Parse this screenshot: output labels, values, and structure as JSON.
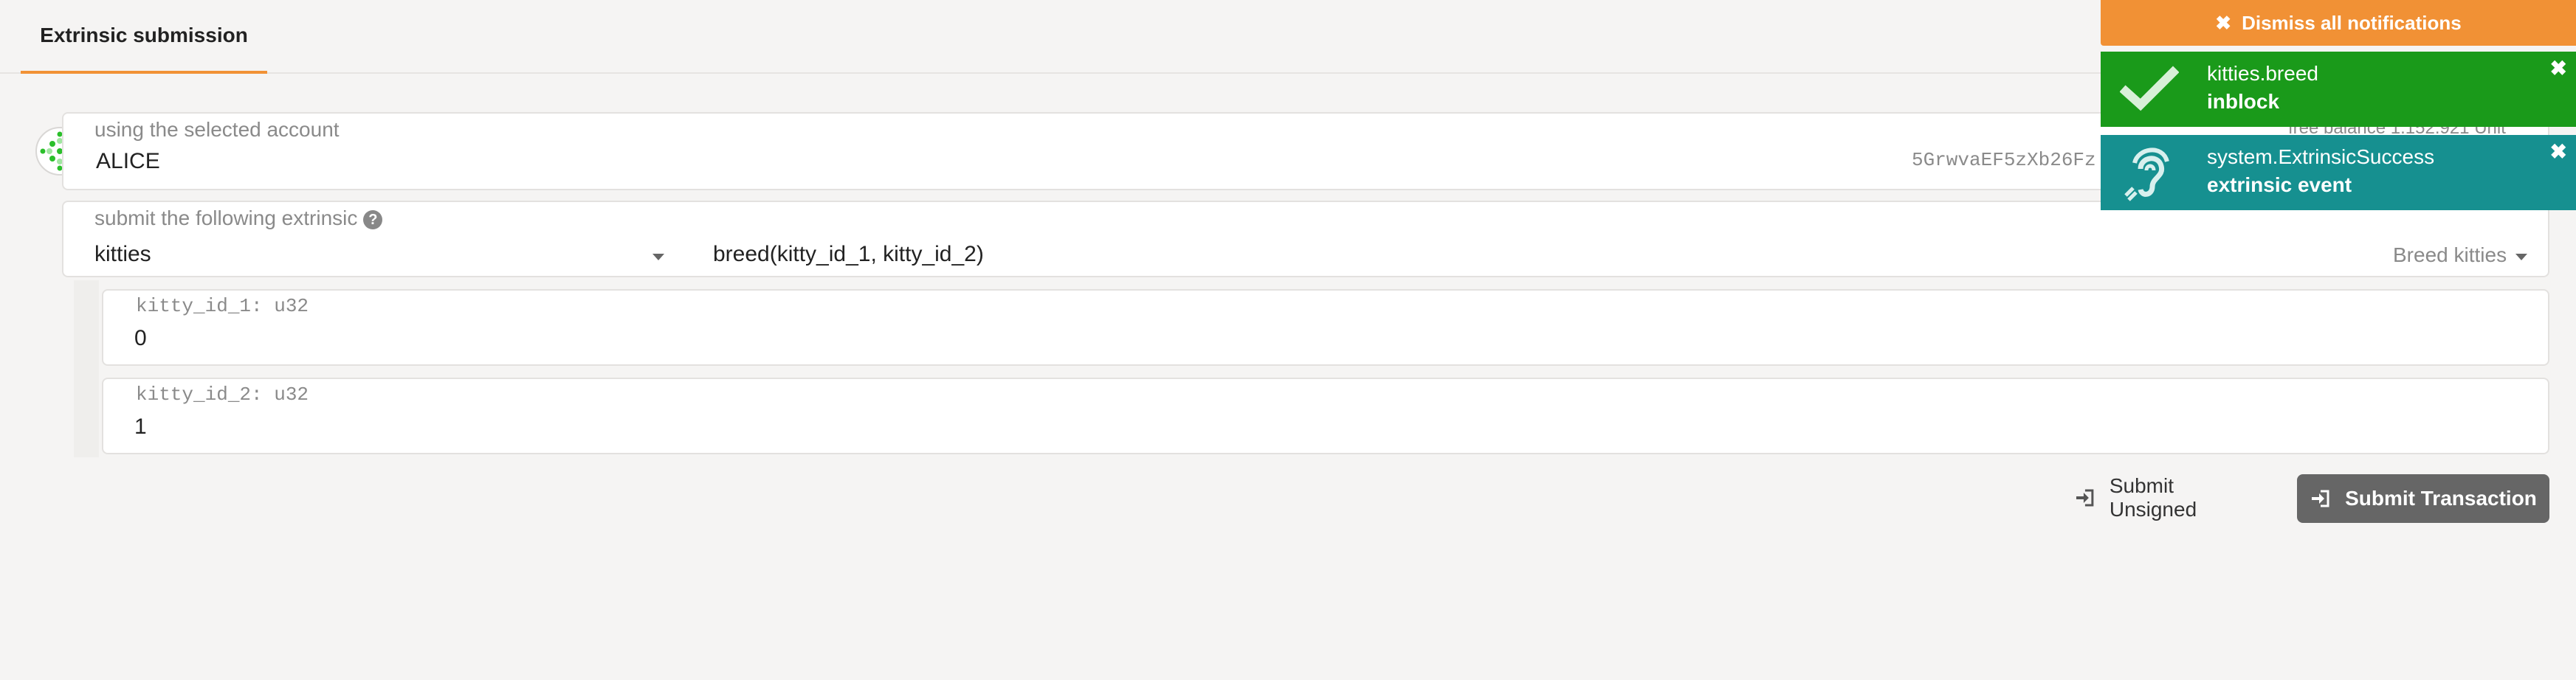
{
  "tabs": [
    {
      "label": "Extrinsic submission"
    }
  ],
  "account": {
    "label": "using the selected account",
    "name": "ALICE",
    "address": "5GrwvaEF5zXb26Fz",
    "free_balance": "free balance 1.152.921 Unit"
  },
  "extrinsic": {
    "label": "submit the following extrinsic",
    "module": "kitties",
    "call": "breed(kitty_id_1, kitty_id_2)",
    "call_hint": "Breed kitties"
  },
  "params": [
    {
      "label": "kitty_id_1: u32",
      "value": "0"
    },
    {
      "label": "kitty_id_2: u32",
      "value": "1"
    }
  ],
  "actions": {
    "submit_unsigned": "Submit Unsigned",
    "submit_transaction": "Submit Transaction"
  },
  "notifications": {
    "dismiss_all": "Dismiss all notifications",
    "items": [
      {
        "title": "kitties.breed",
        "status": "inblock",
        "icon": "check-icon",
        "color": "#1a9a1a"
      },
      {
        "title": "system.ExtrinsicSuccess",
        "status": "extrinsic event",
        "icon": "ear-icon",
        "color": "#169090"
      }
    ]
  },
  "colors": {
    "accent": "#f19135",
    "button": "#666666"
  }
}
